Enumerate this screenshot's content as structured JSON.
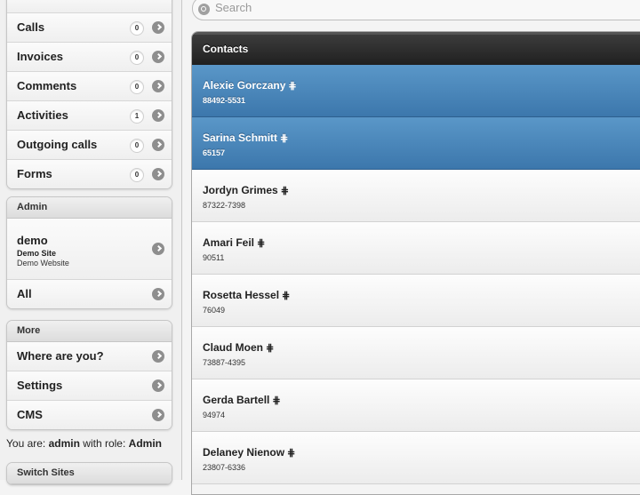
{
  "sidebar": {
    "lists": [
      {
        "label": "Calls",
        "count": "0"
      },
      {
        "label": "Invoices",
        "count": "0"
      },
      {
        "label": "Comments",
        "count": "0"
      },
      {
        "label": "Activities",
        "count": "1"
      },
      {
        "label": "Outgoing calls",
        "count": "0"
      },
      {
        "label": "Forms",
        "count": "0"
      }
    ],
    "admin": {
      "header": "Admin",
      "site": {
        "title": "demo",
        "subtitle": "Demo Site",
        "description": "Demo Website"
      },
      "all_label": "All"
    },
    "more": {
      "header": "More",
      "items": [
        {
          "label": "Where are you?"
        },
        {
          "label": "Settings"
        },
        {
          "label": "CMS"
        }
      ]
    },
    "role": {
      "prefix": "You are:",
      "user": "admin",
      "middle": "with role:",
      "role": "Admin"
    },
    "switch_sites": {
      "header": "Switch Sites"
    }
  },
  "search": {
    "placeholder": "Search"
  },
  "contacts": {
    "header": "Contacts",
    "rows": [
      {
        "name": "Alexie Gorczany",
        "phone": "88492-5531",
        "selected": true
      },
      {
        "name": "Sarina Schmitt",
        "phone": "65157",
        "selected": true
      },
      {
        "name": "Jordyn Grimes",
        "phone": "87322-7398",
        "selected": false
      },
      {
        "name": "Amari Feil",
        "phone": "90511",
        "selected": false
      },
      {
        "name": "Rosetta Hessel",
        "phone": "76049",
        "selected": false
      },
      {
        "name": "Claud Moen",
        "phone": "73887-4395",
        "selected": false
      },
      {
        "name": "Gerda Bartell",
        "phone": "94974",
        "selected": false
      },
      {
        "name": "Delaney Nienow",
        "phone": "23807-6336",
        "selected": false
      }
    ],
    "hash_glyph": "⋕"
  }
}
